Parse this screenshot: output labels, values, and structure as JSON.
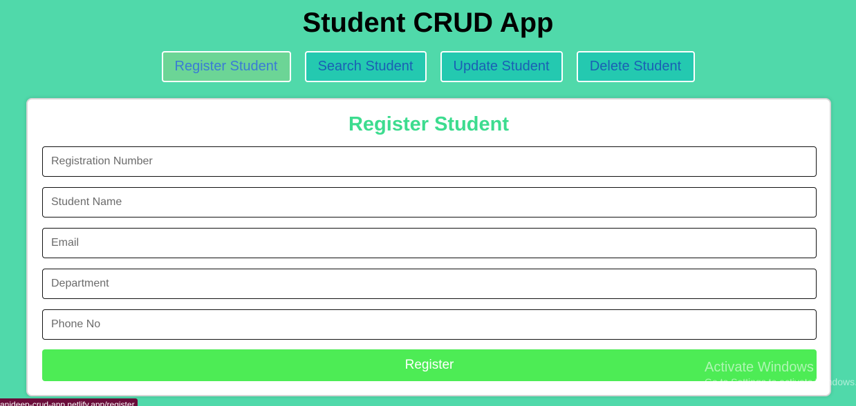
{
  "app": {
    "title": "Student CRUD App"
  },
  "nav": {
    "items": [
      {
        "label": "Register Student",
        "active": true
      },
      {
        "label": "Search Student",
        "active": false
      },
      {
        "label": "Update Student",
        "active": false
      },
      {
        "label": "Delete Student",
        "active": false
      }
    ]
  },
  "form": {
    "title": "Register Student",
    "fields": [
      {
        "placeholder": "Registration Number",
        "value": ""
      },
      {
        "placeholder": "Student Name",
        "value": ""
      },
      {
        "placeholder": "Email",
        "value": ""
      },
      {
        "placeholder": "Department",
        "value": ""
      },
      {
        "placeholder": "Phone No",
        "value": ""
      }
    ],
    "submit_label": "Register"
  },
  "overlay": {
    "watermark_title": "Activate Windows",
    "watermark_subtitle": "Go to Settings to activate Windows.",
    "status_url": "anideep-crud-app.netlify.app/register"
  },
  "colors": {
    "background": "#50d9aa",
    "accent_title": "#3ddc8f",
    "submit": "#4dec55"
  }
}
